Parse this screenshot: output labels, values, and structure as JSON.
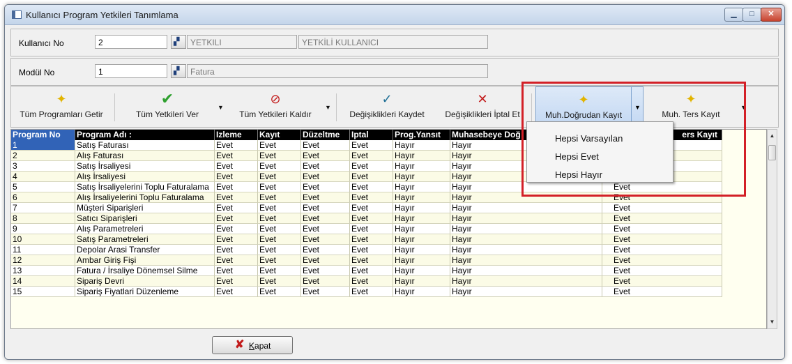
{
  "window": {
    "title": "Kullanıcı Program Yetkileri Tanımlama",
    "min": "▁",
    "max": "□",
    "close": "✕"
  },
  "user": {
    "label": "Kullanıcı No",
    "value": "2",
    "code": "YETKILI",
    "name": "YETKİLİ KULLANICI"
  },
  "module": {
    "label": "Modül No",
    "value": "1",
    "name": "Fatura"
  },
  "toolbar": {
    "get_all": "Tüm Programları Getir",
    "grant_all": "Tüm Yetkileri Ver",
    "revoke_all": "Tüm Yetkileri Kaldır",
    "save": "Değişiklikleri Kaydet",
    "cancel": "Değişiklikleri İptal Et",
    "direct_record": "Muh.Doğrudan Kayıt",
    "reverse_record": "Muh. Ters Kayıt"
  },
  "menu": [
    "Hepsi Varsayılan",
    "Hepsi Evet",
    "Hepsi Hayır"
  ],
  "columns": [
    "Program No",
    "Program Adı :",
    "Izleme",
    "Kayıt",
    "Düzeltme",
    "Iptal",
    "Prog.Yansıt",
    "Muhasebeye Doğ",
    "ers Kayıt"
  ],
  "rows": [
    [
      "1",
      "Satış Faturası",
      "Evet",
      "Evet",
      "Evet",
      "Evet",
      "Hayır",
      "Hayır",
      ""
    ],
    [
      "2",
      "Alış Faturası",
      "Evet",
      "Evet",
      "Evet",
      "Evet",
      "Hayır",
      "Hayır",
      ""
    ],
    [
      "3",
      "Satış İrsaliyesi",
      "Evet",
      "Evet",
      "Evet",
      "Evet",
      "Hayır",
      "Hayır",
      ""
    ],
    [
      "4",
      "Alış İrsaliyesi",
      "Evet",
      "Evet",
      "Evet",
      "Evet",
      "Hayır",
      "Hayır",
      ""
    ],
    [
      "5",
      "Satış İrsaliyelerini Toplu Faturalama",
      "Evet",
      "Evet",
      "Evet",
      "Evet",
      "Hayır",
      "Hayır",
      "Evet"
    ],
    [
      "6",
      "Alış İrsaliyelerini Toplu Faturalama",
      "Evet",
      "Evet",
      "Evet",
      "Evet",
      "Hayır",
      "Hayır",
      "Evet"
    ],
    [
      "7",
      "Müşteri Siparişleri",
      "Evet",
      "Evet",
      "Evet",
      "Evet",
      "Hayır",
      "Hayır",
      "Evet"
    ],
    [
      "8",
      "Satıcı Siparişleri",
      "Evet",
      "Evet",
      "Evet",
      "Evet",
      "Hayır",
      "Hayır",
      "Evet"
    ],
    [
      "9",
      "Alış Parametreleri",
      "Evet",
      "Evet",
      "Evet",
      "Evet",
      "Hayır",
      "Hayır",
      "Evet"
    ],
    [
      "10",
      "Satış Parametreleri",
      "Evet",
      "Evet",
      "Evet",
      "Evet",
      "Hayır",
      "Hayır",
      "Evet"
    ],
    [
      "11",
      "Depolar Arasi Transfer",
      "Evet",
      "Evet",
      "Evet",
      "Evet",
      "Hayır",
      "Hayır",
      "Evet"
    ],
    [
      "12",
      "Ambar Giriş Fişi",
      "Evet",
      "Evet",
      "Evet",
      "Evet",
      "Hayır",
      "Hayır",
      "Evet"
    ],
    [
      "13",
      "Fatura / İrsaliye Dönemsel Silme",
      "Evet",
      "Evet",
      "Evet",
      "Evet",
      "Hayır",
      "Hayır",
      "Evet"
    ],
    [
      "14",
      "Sipariş Devri",
      "Evet",
      "Evet",
      "Evet",
      "Evet",
      "Hayır",
      "Hayır",
      "Evet"
    ],
    [
      "15",
      "Sipariş Fiyatlari Düzenleme",
      "Evet",
      "Evet",
      "Evet",
      "Evet",
      "Hayır",
      "Hayır",
      "Evet"
    ]
  ],
  "close_button": {
    "accel": "K",
    "rest": "apat"
  }
}
